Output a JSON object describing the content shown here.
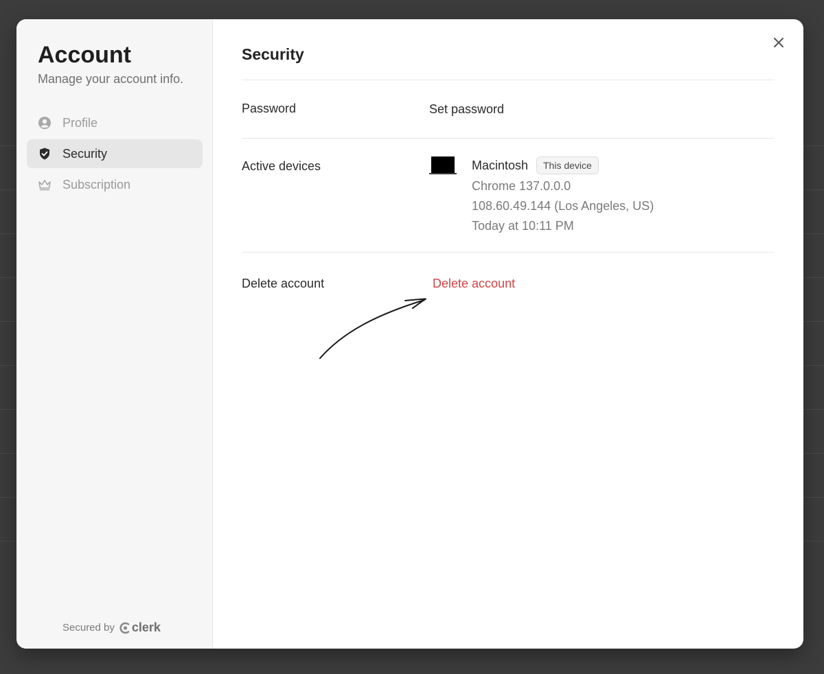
{
  "sidebar": {
    "title": "Account",
    "subtitle": "Manage your account info.",
    "items": [
      {
        "label": "Profile",
        "icon": "user-circle-icon",
        "active": false
      },
      {
        "label": "Security",
        "icon": "shield-check-icon",
        "active": true
      },
      {
        "label": "Subscription",
        "icon": "crown-icon",
        "active": false
      }
    ],
    "secured_by": "Secured by",
    "brand": "clerk"
  },
  "main": {
    "title": "Security",
    "password": {
      "label": "Password",
      "action": "Set password"
    },
    "devices": {
      "label": "Active devices",
      "items": [
        {
          "name": "Macintosh",
          "badge": "This device",
          "browser": "Chrome 137.0.0.0",
          "location": "108.60.49.144 (Los Angeles, US)",
          "last_active": "Today at 10:11 PM"
        }
      ]
    },
    "delete": {
      "label": "Delete account",
      "action": "Delete account"
    }
  },
  "colors": {
    "danger": "#d14343",
    "sidebar_bg": "#f6f6f6",
    "active_item_bg": "#e6e6e6",
    "backdrop": "#3c3c3c"
  }
}
